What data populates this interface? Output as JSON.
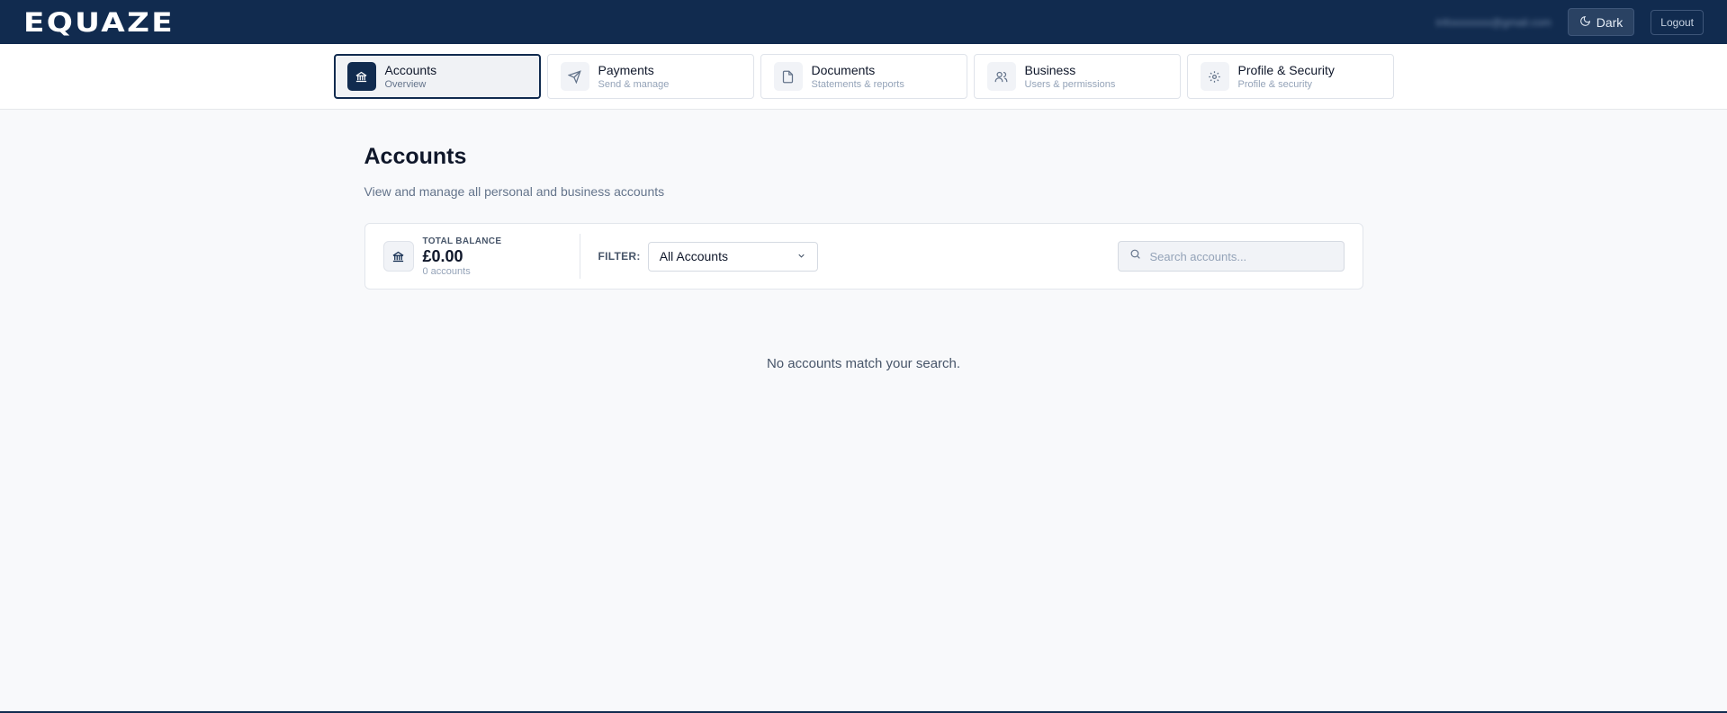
{
  "header": {
    "logo": "EQUAZE",
    "user_email": "infoxxxxxxx@gmail.com",
    "theme_button_label": "Dark",
    "logout_label": "Logout"
  },
  "nav": {
    "tabs": [
      {
        "title": "Accounts",
        "subtitle": "Overview",
        "icon": "bank-icon",
        "active": true
      },
      {
        "title": "Payments",
        "subtitle": "Send & manage",
        "icon": "send-icon",
        "active": false
      },
      {
        "title": "Documents",
        "subtitle": "Statements & reports",
        "icon": "document-icon",
        "active": false
      },
      {
        "title": "Business",
        "subtitle": "Users & permissions",
        "icon": "users-icon",
        "active": false
      },
      {
        "title": "Profile & Security",
        "subtitle": "Profile & security",
        "icon": "gear-icon",
        "active": false
      }
    ]
  },
  "main": {
    "title": "Accounts",
    "subtitle": "View and manage all personal and business accounts",
    "summary": {
      "label": "TOTAL BALANCE",
      "amount": "£0.00",
      "count": "0 accounts"
    },
    "filter": {
      "label": "FILTER:",
      "selected": "All Accounts"
    },
    "search": {
      "placeholder": "Search accounts...",
      "value": ""
    },
    "empty_message": "No accounts match your search."
  },
  "colors": {
    "brand": "#112b4f",
    "background": "#f8f9fb"
  }
}
